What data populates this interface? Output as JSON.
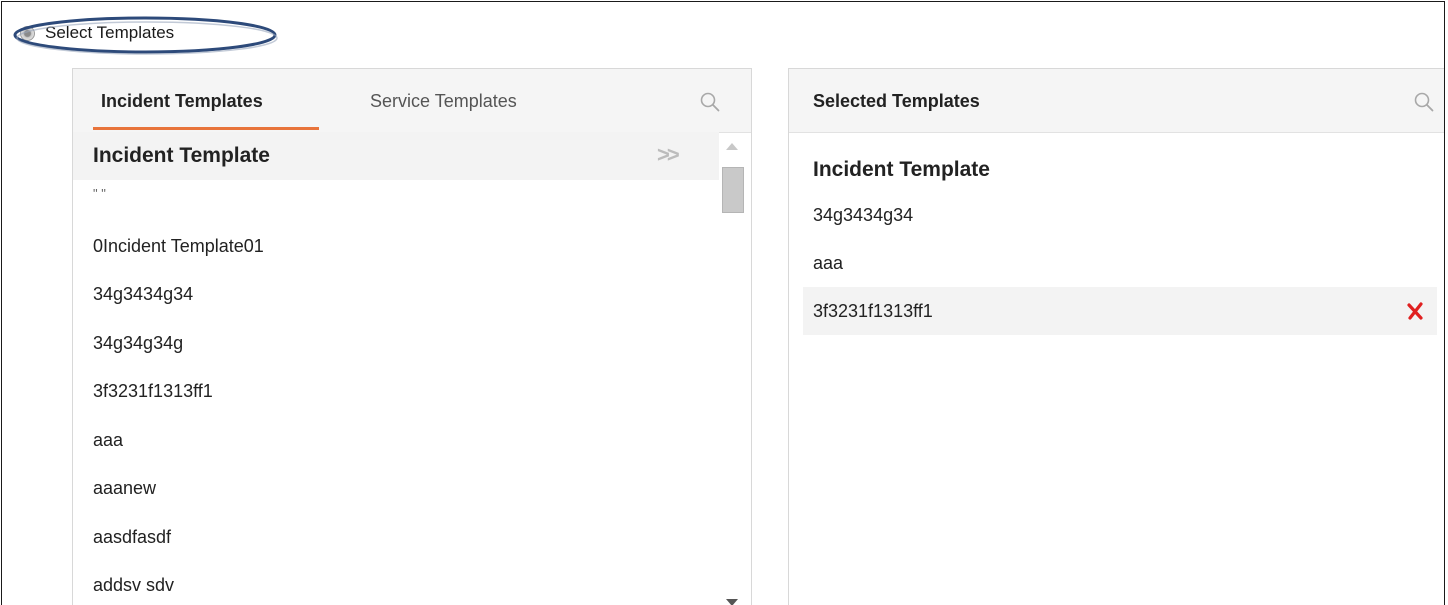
{
  "selector": {
    "label": "Select Templates"
  },
  "available": {
    "tabs": [
      {
        "label": "Incident Templates",
        "active": true
      },
      {
        "label": "Service Templates",
        "active": false
      }
    ],
    "group_title": "Incident Template",
    "move_all_glyph": ">>",
    "items": [
      "\" \"",
      "0Incident Template01",
      "34g3434g34",
      "34g34g34g",
      "3f3231f1313ff1",
      "aaa",
      "aaanew",
      "aasdfasdf",
      "addsv sdv"
    ],
    "icons": {
      "search": "search-icon",
      "move_all": "double-chevron-right-icon"
    }
  },
  "selected": {
    "title": "Selected Templates",
    "group_title": "Incident Template",
    "items": [
      "34g3434g34",
      "aaa",
      "3f3231f1313ff1"
    ],
    "icons": {
      "search": "search-icon",
      "remove": "remove-x-icon"
    }
  },
  "colors": {
    "accent": "#e8743b",
    "remove": "#e02020",
    "annotation": "#2d4a7a"
  }
}
